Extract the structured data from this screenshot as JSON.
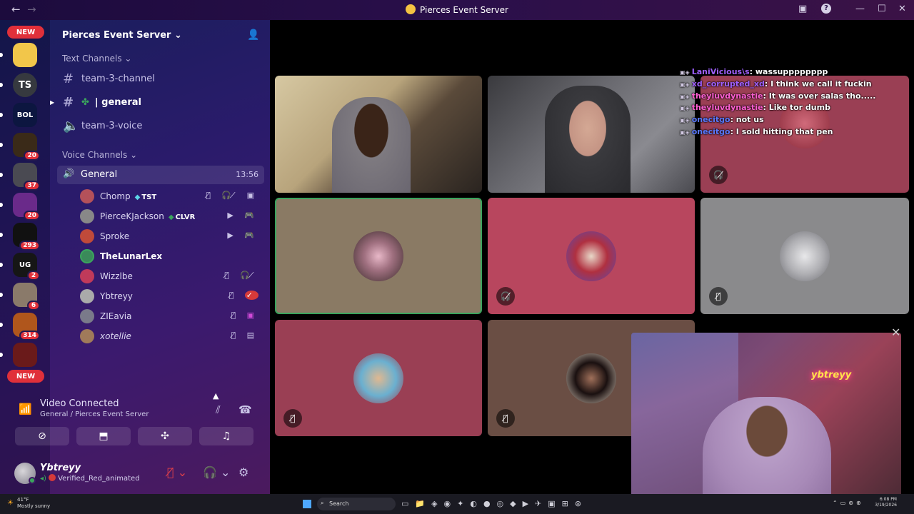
{
  "window": {
    "title": "Pierces Event Server",
    "back_icon": "←",
    "forward_icon": "→"
  },
  "guild_sidebar": {
    "new_label": "NEW",
    "items": [
      {
        "label": "",
        "color": "#f2c64a",
        "badge": ""
      },
      {
        "label": "TS",
        "color": "#36393f",
        "badge": ""
      },
      {
        "label": "BOL",
        "color": "#0c1640",
        "badge": ""
      },
      {
        "label": "",
        "color": "#3a2a18",
        "badge": "20"
      },
      {
        "label": "",
        "color": "#4a4a52",
        "badge": "37"
      },
      {
        "label": "",
        "color": "#6a2a8a",
        "badge": "20"
      },
      {
        "label": "",
        "color": "#111",
        "badge": "293"
      },
      {
        "label": "UG",
        "color": "#161616",
        "badge": "2"
      },
      {
        "label": "",
        "color": "#8a7a6a",
        "badge": "6"
      },
      {
        "label": "",
        "color": "#b0561c",
        "badge": "314"
      },
      {
        "label": "",
        "color": "#6a1a1a",
        "badge": ""
      }
    ]
  },
  "server": {
    "name": "Pierces Event Server",
    "text_category": "Text Channels",
    "text_channels": [
      {
        "name": "team-3-channel"
      },
      {
        "name": "| general"
      },
      {
        "name": "team-3-voice"
      }
    ],
    "voice_category": "Voice Channels",
    "voice_channel": {
      "name": "General",
      "time": "13:56"
    },
    "members": [
      {
        "name": "Chomp",
        "tag": "TST",
        "color": "#b4515a"
      },
      {
        "name": "PierceKJackson",
        "tag": "CLVR",
        "color": "#888"
      },
      {
        "name": "Sproke",
        "tag": "",
        "color": "#c04a3a"
      },
      {
        "name": "TheLunarLex",
        "tag": "",
        "color": "#3a8a5a"
      },
      {
        "name": "Wizzlbe",
        "tag": "",
        "color": "#c03a5a"
      },
      {
        "name": "Ybtreyy",
        "tag": "",
        "color": "#aaa"
      },
      {
        "name": "ZIEavia",
        "tag": "",
        "color": "#7a7a8a"
      },
      {
        "name": "xotellie",
        "tag": "",
        "color": "#a07a5a"
      }
    ]
  },
  "voice_status": {
    "status": "Video Connected",
    "location": "General / Pierces Event Server"
  },
  "user": {
    "name": "Ybtreyy",
    "status": "Verified_Red_animated"
  },
  "overlay_chat": [
    {
      "user": "LaniVicious\\s",
      "msg": ": wassupppppppp",
      "cls": "u1"
    },
    {
      "user": "xd_corrupted_xd",
      "msg": ": I think we call it fuckin",
      "cls": "u1"
    },
    {
      "user": "theyluvdynastie",
      "msg": ": It was over salas tho.....",
      "cls": "u4"
    },
    {
      "user": "theyluvdynastie",
      "msg": ": Like tor dumb",
      "cls": "u4"
    },
    {
      "user": "onecitgo",
      "msg": ": not us",
      "cls": "u3"
    },
    {
      "user": "onecitgo",
      "msg": ": I sold hitting that pen",
      "cls": "u3"
    }
  ],
  "popout": {
    "neon": "ybtreyy"
  },
  "taskbar": {
    "weather_temp": "41°F",
    "weather_text": "Mostly sunny",
    "search_label": "Search",
    "time": "6:08 PM",
    "date": "3/19/2026"
  }
}
